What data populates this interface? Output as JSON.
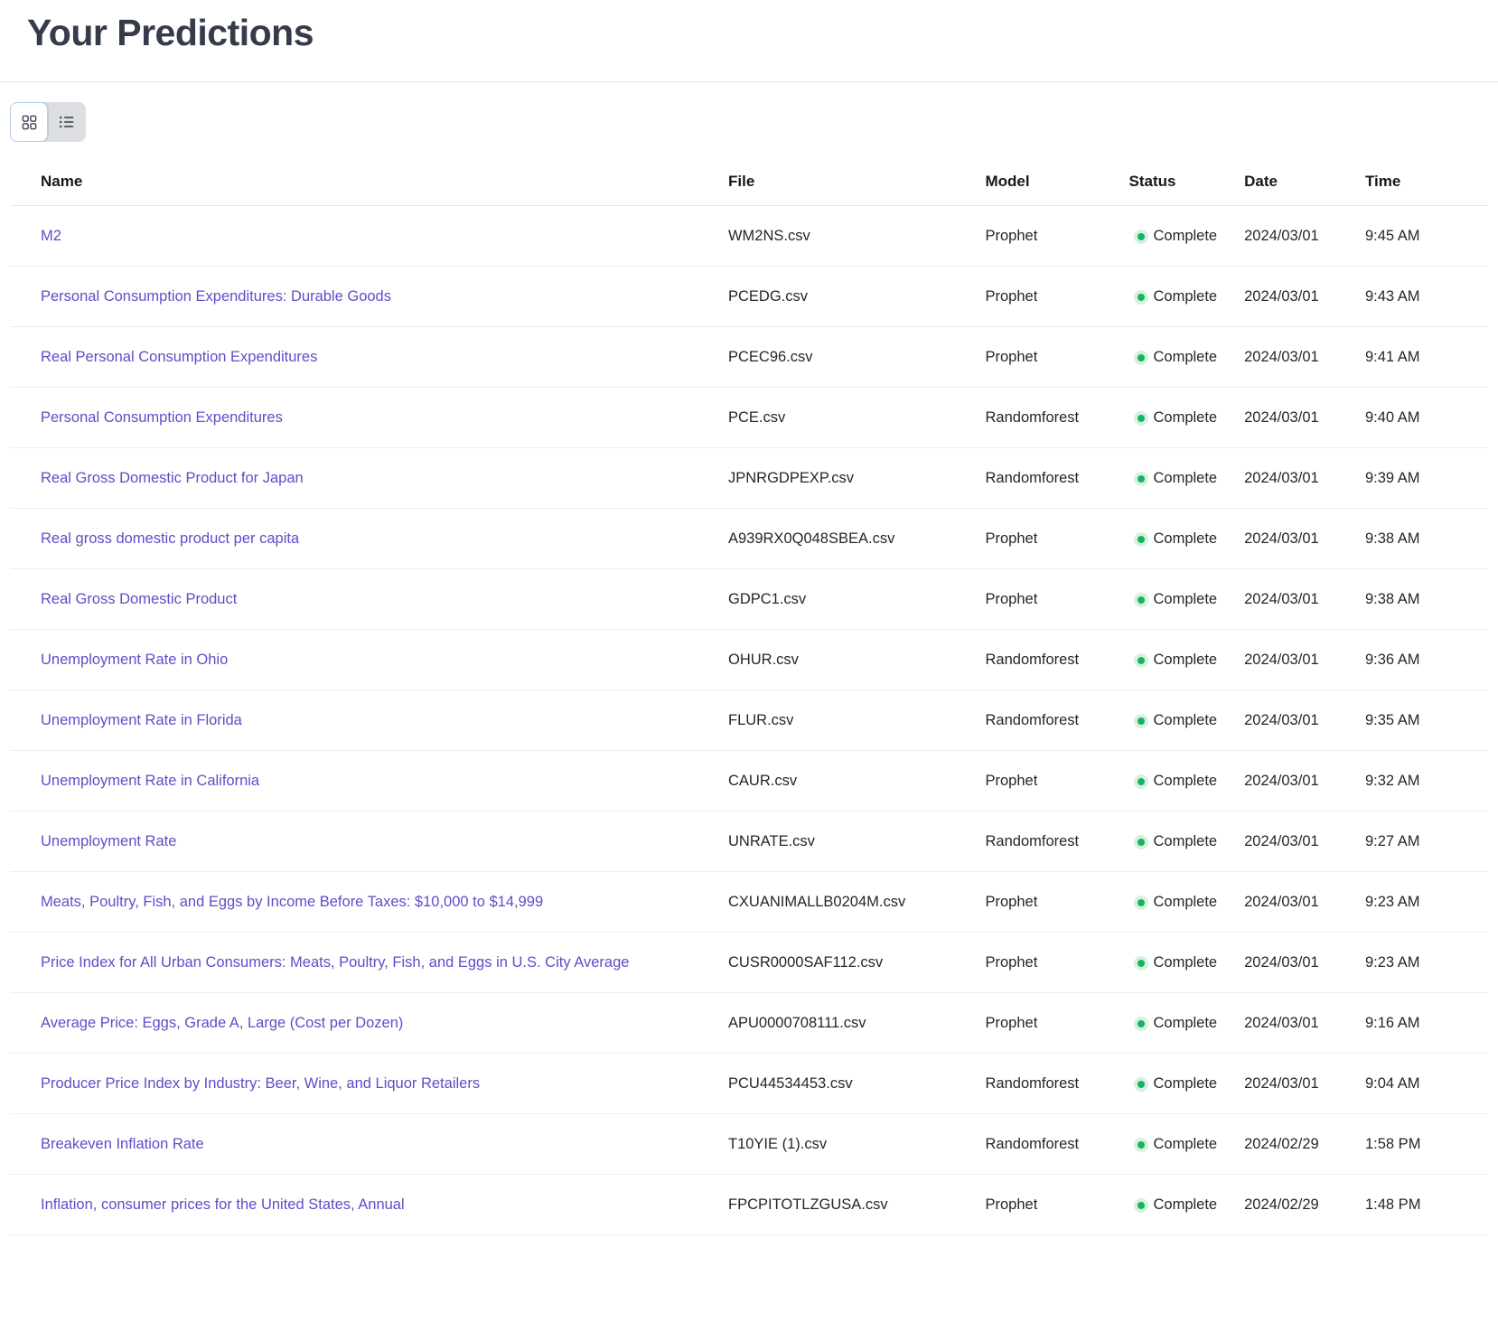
{
  "header": {
    "title": "Your Predictions"
  },
  "toolbar": {
    "grid_view_icon": "grid-view-icon",
    "list_view_icon": "list-view-icon",
    "active_view": "grid"
  },
  "table": {
    "columns": [
      {
        "key": "name",
        "label": "Name"
      },
      {
        "key": "file",
        "label": "File"
      },
      {
        "key": "model",
        "label": "Model"
      },
      {
        "key": "status",
        "label": "Status"
      },
      {
        "key": "date",
        "label": "Date"
      },
      {
        "key": "time",
        "label": "Time"
      }
    ],
    "status_dot_color": "#19b35f",
    "link_color": "#5b4fc9",
    "rows": [
      {
        "name": "M2",
        "file": "WM2NS.csv",
        "model": "Prophet",
        "status": "Complete",
        "date": "2024/03/01",
        "time": "9:45 AM"
      },
      {
        "name": "Personal Consumption Expenditures: Durable Goods",
        "file": "PCEDG.csv",
        "model": "Prophet",
        "status": "Complete",
        "date": "2024/03/01",
        "time": "9:43 AM"
      },
      {
        "name": "Real Personal Consumption Expenditures",
        "file": "PCEC96.csv",
        "model": "Prophet",
        "status": "Complete",
        "date": "2024/03/01",
        "time": "9:41 AM"
      },
      {
        "name": "Personal Consumption Expenditures",
        "file": "PCE.csv",
        "model": "Randomforest",
        "status": "Complete",
        "date": "2024/03/01",
        "time": "9:40 AM"
      },
      {
        "name": "Real Gross Domestic Product for Japan",
        "file": "JPNRGDPEXP.csv",
        "model": "Randomforest",
        "status": "Complete",
        "date": "2024/03/01",
        "time": "9:39 AM"
      },
      {
        "name": "Real gross domestic product per capita",
        "file": "A939RX0Q048SBEA.csv",
        "model": "Prophet",
        "status": "Complete",
        "date": "2024/03/01",
        "time": "9:38 AM"
      },
      {
        "name": "Real Gross Domestic Product",
        "file": "GDPC1.csv",
        "model": "Prophet",
        "status": "Complete",
        "date": "2024/03/01",
        "time": "9:38 AM"
      },
      {
        "name": "Unemployment Rate in Ohio",
        "file": "OHUR.csv",
        "model": "Randomforest",
        "status": "Complete",
        "date": "2024/03/01",
        "time": "9:36 AM"
      },
      {
        "name": "Unemployment Rate in Florida",
        "file": "FLUR.csv",
        "model": "Randomforest",
        "status": "Complete",
        "date": "2024/03/01",
        "time": "9:35 AM"
      },
      {
        "name": "Unemployment Rate in California",
        "file": "CAUR.csv",
        "model": "Prophet",
        "status": "Complete",
        "date": "2024/03/01",
        "time": "9:32 AM"
      },
      {
        "name": "Unemployment Rate",
        "file": "UNRATE.csv",
        "model": "Randomforest",
        "status": "Complete",
        "date": "2024/03/01",
        "time": "9:27 AM"
      },
      {
        "name": "Meats, Poultry, Fish, and Eggs by Income Before Taxes: $10,000 to $14,999",
        "file": "CXUANIMALLB0204M.csv",
        "model": "Prophet",
        "status": "Complete",
        "date": "2024/03/01",
        "time": "9:23 AM"
      },
      {
        "name": "Price Index for All Urban Consumers: Meats, Poultry, Fish, and Eggs in U.S. City Average",
        "file": "CUSR0000SAF112.csv",
        "model": "Prophet",
        "status": "Complete",
        "date": "2024/03/01",
        "time": "9:23 AM"
      },
      {
        "name": "Average Price: Eggs, Grade A, Large (Cost per Dozen)",
        "file": "APU0000708111.csv",
        "model": "Prophet",
        "status": "Complete",
        "date": "2024/03/01",
        "time": "9:16 AM"
      },
      {
        "name": "Producer Price Index by Industry: Beer, Wine, and Liquor Retailers",
        "file": "PCU44534453.csv",
        "model": "Randomforest",
        "status": "Complete",
        "date": "2024/03/01",
        "time": "9:04 AM"
      },
      {
        "name": "Breakeven Inflation Rate",
        "file": "T10YIE (1).csv",
        "model": "Randomforest",
        "status": "Complete",
        "date": "2024/02/29",
        "time": "1:58 PM"
      },
      {
        "name": "Inflation, consumer prices for the United States, Annual",
        "file": "FPCPITOTLZGUSA.csv",
        "model": "Prophet",
        "status": "Complete",
        "date": "2024/02/29",
        "time": "1:48 PM"
      }
    ]
  }
}
